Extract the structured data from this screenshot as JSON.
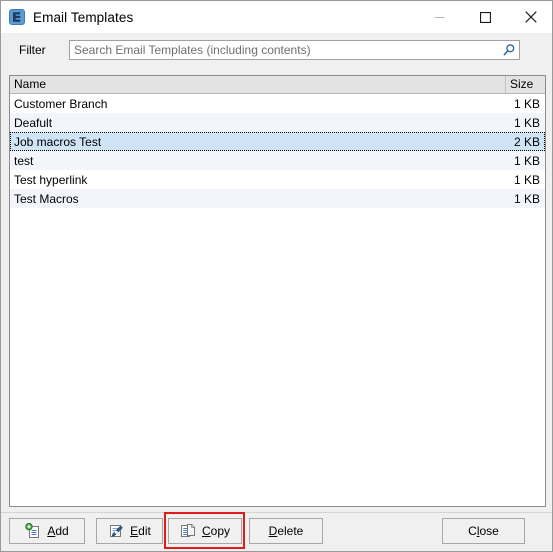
{
  "window": {
    "title": "Email Templates",
    "icon": "email-template-app-icon",
    "controls": [
      {
        "name": "minimize",
        "glyph": "minimize-icon",
        "enabled": false
      },
      {
        "name": "maximize",
        "glyph": "maximize-icon",
        "enabled": true
      },
      {
        "name": "close",
        "glyph": "close-icon",
        "enabled": true
      }
    ]
  },
  "filter": {
    "label": "Filter",
    "value": "",
    "placeholder": "Search Email Templates (including contents)",
    "search_icon": "magnifier-icon"
  },
  "list": {
    "columns": [
      {
        "key": "name",
        "label": "Name"
      },
      {
        "key": "size",
        "label": "Size"
      }
    ],
    "rows": [
      {
        "name": "Customer Branch",
        "size": "1 KB",
        "selected": false
      },
      {
        "name": "Deafult",
        "size": "1 KB",
        "selected": false
      },
      {
        "name": "Job macros Test",
        "size": "2 KB",
        "selected": true
      },
      {
        "name": "test",
        "size": "1 KB",
        "selected": false
      },
      {
        "name": "Test hyperlink",
        "size": "1 KB",
        "selected": false
      },
      {
        "name": "Test Macros",
        "size": "1 KB",
        "selected": false
      }
    ]
  },
  "buttons": {
    "add": {
      "label": "Add",
      "accel": "A",
      "icon": "new-document-icon"
    },
    "edit": {
      "label": "Edit",
      "accel": "E",
      "icon": "edit-document-icon"
    },
    "copy": {
      "label": "Copy",
      "accel": "C",
      "icon": "copy-documents-icon"
    },
    "delete": {
      "label": "Delete",
      "accel": "D",
      "icon": null
    },
    "close": {
      "label": "Close",
      "accel": "l",
      "icon": null
    }
  },
  "annotation": {
    "highlight_target": "copy-button",
    "highlight_color": "#e01b1b"
  },
  "colors": {
    "titlebar_bg": "#ffffff",
    "dialog_bg": "#f0f0f0",
    "list_bg": "#ffffff",
    "row_alt_bg": "#f2f6fb",
    "selection_bg": "#cfe4f7",
    "header_bg": "#e3e3e3",
    "accent_blue": "#2a6099",
    "add_green": "#3aa33a"
  }
}
